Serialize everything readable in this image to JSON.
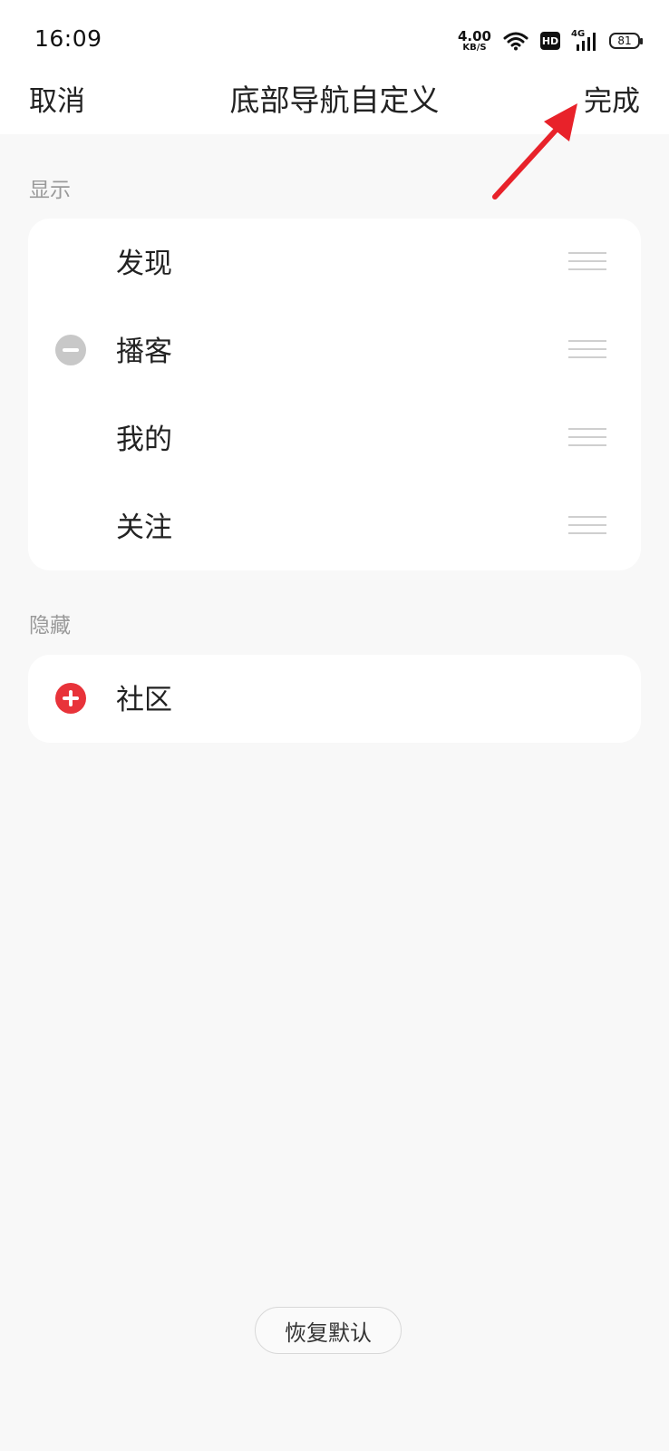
{
  "status_bar": {
    "time": "16:09",
    "net_speed_value": "4.00",
    "net_speed_unit": "KB/S",
    "hd_badge": "HD",
    "network": "4G",
    "battery": "81",
    "icons": [
      "wifi-icon",
      "signal-icon",
      "battery-icon"
    ]
  },
  "nav": {
    "cancel_label": "取消",
    "title": "底部导航自定义",
    "done_label": "完成"
  },
  "sections": {
    "shown_label": "显示",
    "shown_items": [
      {
        "label": "发现",
        "removable": false
      },
      {
        "label": "播客",
        "removable": true
      },
      {
        "label": "我的",
        "removable": false
      },
      {
        "label": "关注",
        "removable": false
      }
    ],
    "hidden_label": "隐藏",
    "hidden_items": [
      {
        "label": "社区"
      }
    ]
  },
  "restore_default_label": "恢复默认",
  "colors": {
    "accent_red": "#e8333a",
    "remove_gray": "#c8c8c8",
    "background": "#f8f8f8",
    "card": "#ffffff",
    "annotation_arrow": "#e8222a"
  }
}
